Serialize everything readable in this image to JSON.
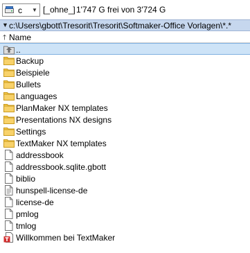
{
  "drive": {
    "letter": "c",
    "label": "[_ohne_]",
    "free_text": "1'747 G frei von 3'724 G"
  },
  "path": {
    "text": "c:\\Users\\gbott\\Tresorit\\Tresorit\\Softmaker-Office Vorlagen\\*.*"
  },
  "header": {
    "name_label": "Name"
  },
  "items": [
    {
      "label": "..",
      "type": "up"
    },
    {
      "label": "Backup",
      "type": "folder"
    },
    {
      "label": "Beispiele",
      "type": "folder"
    },
    {
      "label": "Bullets",
      "type": "folder"
    },
    {
      "label": "Languages",
      "type": "folder"
    },
    {
      "label": "PlanMaker NX templates",
      "type": "folder"
    },
    {
      "label": "Presentations NX designs",
      "type": "folder"
    },
    {
      "label": "Settings",
      "type": "folder"
    },
    {
      "label": "TextMaker NX templates",
      "type": "folder"
    },
    {
      "label": "addressbook",
      "type": "file"
    },
    {
      "label": "addressbook.sqlite.gbott",
      "type": "file"
    },
    {
      "label": "biblio",
      "type": "file"
    },
    {
      "label": "hunspell-license-de",
      "type": "text"
    },
    {
      "label": "license-de",
      "type": "file"
    },
    {
      "label": "pmlog",
      "type": "file"
    },
    {
      "label": "tmlog",
      "type": "file"
    },
    {
      "label": "Willkommen bei TextMaker",
      "type": "textmaker"
    }
  ],
  "colors": {
    "path_bar": "#c6d7ee",
    "folder": "#f2c94c",
    "selection": "#cde3f7"
  }
}
